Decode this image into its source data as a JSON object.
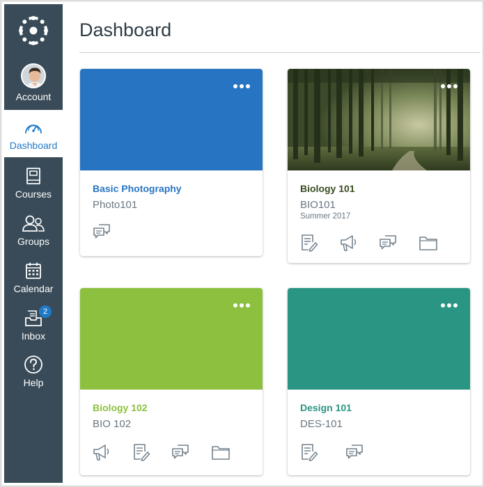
{
  "colors": {
    "sidebar_bg": "#394b58",
    "active_text": "#1f7ac7",
    "photography": "#2774c2",
    "biology102": "#8dc03f",
    "design101": "#2a9583",
    "biology101_title": "#394b20"
  },
  "sidebar": {
    "items": [
      {
        "label": "Account",
        "icon": "avatar"
      },
      {
        "label": "Dashboard",
        "icon": "dashboard-icon",
        "active": true
      },
      {
        "label": "Courses",
        "icon": "courses-icon"
      },
      {
        "label": "Groups",
        "icon": "groups-icon"
      },
      {
        "label": "Calendar",
        "icon": "calendar-icon"
      },
      {
        "label": "Inbox",
        "icon": "inbox-icon",
        "badge": "2"
      },
      {
        "label": "Help",
        "icon": "help-icon"
      }
    ]
  },
  "header": {
    "title": "Dashboard"
  },
  "cards": [
    {
      "title": "Basic Photography",
      "code": "Photo101",
      "term": "",
      "actions": [
        "discussions-icon"
      ]
    },
    {
      "title": "Biology 101",
      "code": "BIO101",
      "term": "Summer 2017",
      "actions": [
        "assignments-icon",
        "announcements-icon",
        "discussions-icon",
        "files-icon"
      ]
    },
    {
      "title": "Biology 102",
      "code": "BIO 102",
      "term": "",
      "actions": [
        "announcements-icon",
        "assignments-icon",
        "discussions-icon",
        "files-icon"
      ]
    },
    {
      "title": "Design 101",
      "code": "DES-101",
      "term": "",
      "actions": [
        "assignments-icon",
        "discussions-icon"
      ]
    }
  ]
}
